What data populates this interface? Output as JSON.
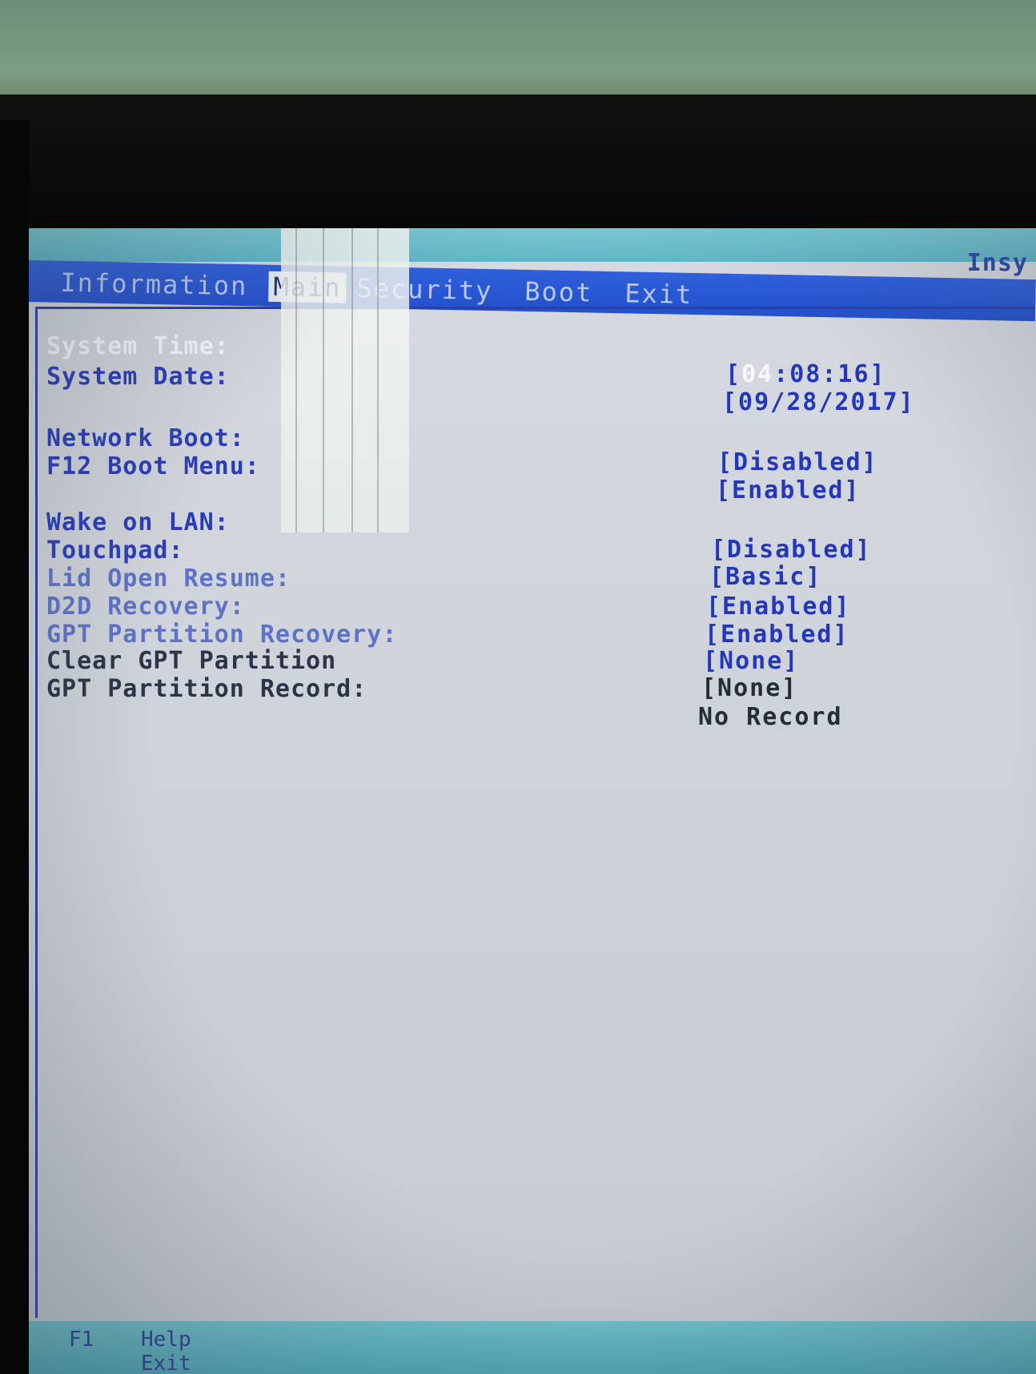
{
  "menu": {
    "items": [
      {
        "label": "Information",
        "active": false
      },
      {
        "label": "Main",
        "active": true
      },
      {
        "label": "Security",
        "active": false
      },
      {
        "label": "Boot",
        "active": false
      },
      {
        "label": "Exit",
        "active": false
      }
    ],
    "vendor": "Insy"
  },
  "settings": [
    {
      "label": "System Time:",
      "value": "",
      "value_prefix": "[",
      "value_highlight": "04",
      "value_suffix": ":08:16]"
    },
    {
      "label": "System Date:",
      "value": "[09/28/2017]"
    },
    {
      "label": "Network Boot:",
      "value": ""
    },
    {
      "label": "F12 Boot Menu:",
      "value": "[Disabled]"
    },
    {
      "label": "",
      "value": "[Enabled]"
    },
    {
      "label": "Wake on LAN:",
      "value": ""
    },
    {
      "label": "Touchpad:",
      "value": "[Disabled]"
    },
    {
      "label": "Lid Open Resume:",
      "value": "[Basic]"
    },
    {
      "label": "D2D Recovery:",
      "value": "[Enabled]"
    },
    {
      "label": "GPT Partition Recovery:",
      "value": "[Enabled]"
    },
    {
      "label": "Clear GPT Partition",
      "value": "[None]"
    },
    {
      "label": "GPT Partition Record:",
      "value": "[None]"
    },
    {
      "label": "",
      "value": "No Record"
    }
  ],
  "help": {
    "key": "F1",
    "help_label": "Help",
    "exit_label": "Exit"
  },
  "colors": {
    "menubar": "#2451cc",
    "label_blue": "#2a3db8",
    "screen_bg": "#d0d4da",
    "selected": "#f7f8fb"
  }
}
